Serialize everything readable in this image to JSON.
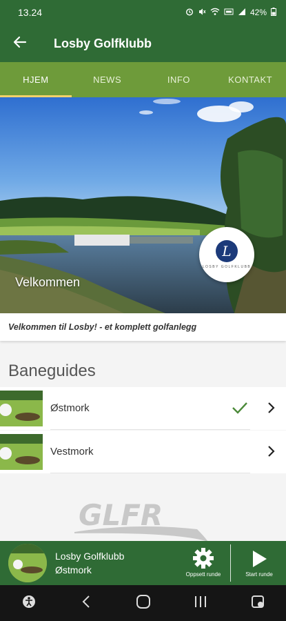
{
  "status_bar": {
    "time": "13.24",
    "battery": "42%",
    "icons": [
      "alarm-icon",
      "mute-icon",
      "wifi-icon",
      "lte-icon",
      "signal-icon",
      "battery-icon"
    ]
  },
  "app_bar": {
    "title": "Losby Golfklubb",
    "back_icon": "arrow-left-icon"
  },
  "tabs": [
    {
      "label": "HJEM",
      "active": true
    },
    {
      "label": "NEWS",
      "active": false
    },
    {
      "label": "INFO",
      "active": false
    },
    {
      "label": "KONTAKT",
      "active": false
    }
  ],
  "hero": {
    "caption": "Velkommen",
    "logo_letter": "L",
    "logo_text": "LOSBY GOLFKLUBB"
  },
  "welcome_text": "Velkommen til Losby! - et komplett golfanlegg",
  "baneguides": {
    "title": "Baneguides",
    "items": [
      {
        "label": "Østmork",
        "selected": true
      },
      {
        "label": "Vestmork",
        "selected": false
      }
    ]
  },
  "watermark": "GLFR",
  "player": {
    "club": "Losby Golfklubb",
    "course": "Østmork",
    "setup_label": "Oppsett runde",
    "start_label": "Start runde"
  },
  "colors": {
    "primary": "#2f6b35",
    "tab_bar": "#6e9b3a",
    "tab_indicator": "#f3d26a",
    "check": "#4c8a3a"
  }
}
